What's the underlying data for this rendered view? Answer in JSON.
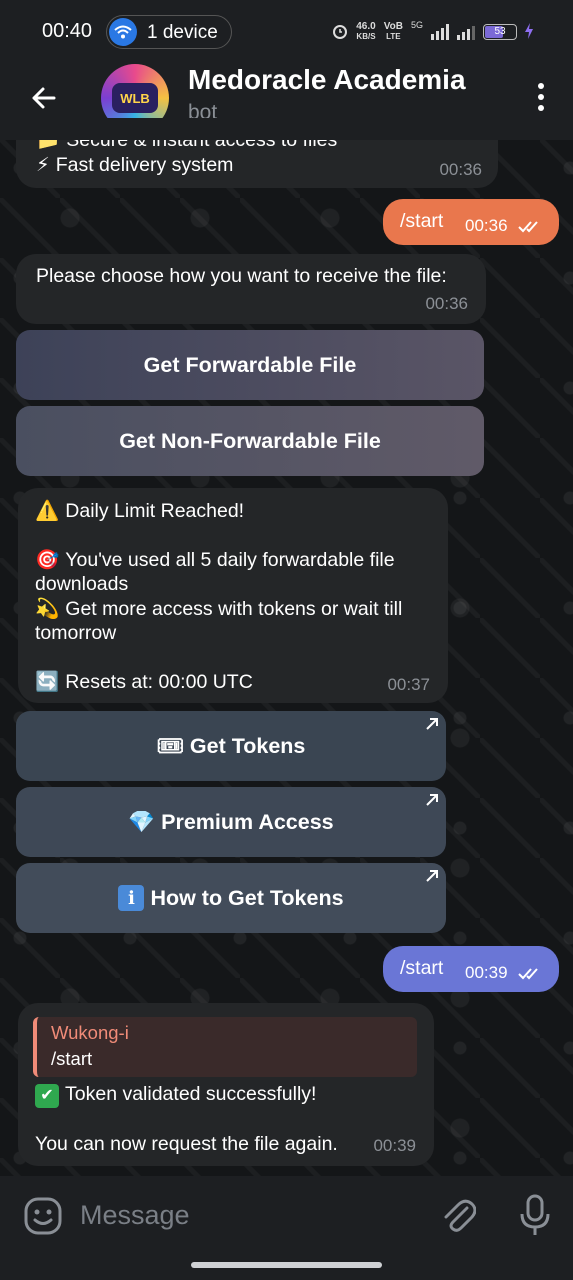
{
  "status_bar": {
    "time": "00:40",
    "device_label": "1 device",
    "net_speed_value": "46.0",
    "net_speed_unit": "KB/S",
    "volte_top": "VoB",
    "volte_bottom": "LTE",
    "network": "5G",
    "battery": "53"
  },
  "header": {
    "title": "Medoracle Academia",
    "subtitle": "bot",
    "avatar_text": "WLB"
  },
  "messages": {
    "m1": {
      "line1": "Secure & instant access to files",
      "line2": "Fast delivery system",
      "time": "00:36"
    },
    "out1": {
      "text": "/start",
      "time": "00:36"
    },
    "m2": {
      "text": "Please choose how you want to receive the file:",
      "time": "00:36"
    },
    "kb1": [
      {
        "label": "Get Forwardable File"
      },
      {
        "label": "Get Non-Forwardable File"
      }
    ],
    "m3": {
      "line1": "Daily Limit Reached!",
      "line2": "You've used all 5 daily forwardable file downloads",
      "line3": "Get more access with tokens or wait till tomorrow",
      "line4": "Resets at: 00:00 UTC",
      "time": "00:37"
    },
    "kb2": [
      {
        "label": "Get Tokens",
        "icon": "🎟"
      },
      {
        "label": "Premium Access",
        "icon": "💎"
      },
      {
        "label": "How to Get Tokens",
        "icon": "ℹ"
      }
    ],
    "out2": {
      "text": "/start",
      "time": "00:39"
    },
    "m4": {
      "reply_name": "Wukong-i",
      "reply_text": "/start",
      "line1": "Token validated successfully!",
      "line2": "You can now request the file again.",
      "time": "00:39"
    }
  },
  "input": {
    "placeholder": "Message"
  },
  "colors": {
    "out_bubble_1": "#e9774d",
    "out_bubble_2": "#6a76d6",
    "reply_accent": "#f08b78"
  }
}
